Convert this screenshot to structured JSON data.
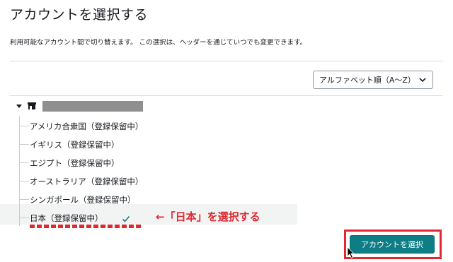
{
  "title": "アカウントを選択する",
  "description": "利用可能なアカウント間で切り替えます。 この選択は、ヘッダーを通じていつでも変更できます。",
  "sort": {
    "selected": "アルファベット順（A〜Z）"
  },
  "tree": {
    "items": [
      {
        "label": "アメリカ合衆国（登録保留中）"
      },
      {
        "label": "イギリス（登録保留中）"
      },
      {
        "label": "エジプト（登録保留中）"
      },
      {
        "label": "オーストラリア（登録保留中）"
      },
      {
        "label": "シンガポール（登録保留中）"
      },
      {
        "label": "日本（登録保留中）"
      }
    ]
  },
  "annotation": "←「日本」を選択する",
  "confirm_button": "アカウントを選択",
  "colors": {
    "accent": "#0d7d86",
    "annotation_red": "#e0282e"
  },
  "icons": [
    "caret-down-icon",
    "store-icon",
    "chevron-down-icon",
    "checkmark-icon",
    "mouse-cursor-icon"
  ]
}
